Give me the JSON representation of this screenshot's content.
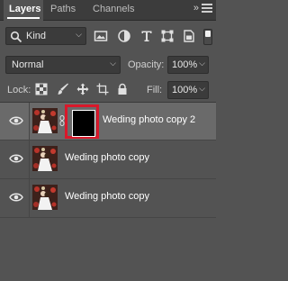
{
  "tabs": [
    {
      "label": "Layers",
      "active": true
    },
    {
      "label": "Paths",
      "active": false
    },
    {
      "label": "Channels",
      "active": false
    }
  ],
  "tabbar": {
    "collapse_label": "»",
    "menu_icon": "panel-menu-icon"
  },
  "filter": {
    "kind_label": "Kind",
    "filter_icons": [
      "pixel-layer-filter-icon",
      "adjustment-layer-filter-icon",
      "type-layer-filter-icon",
      "shape-layer-filter-icon",
      "smart-object-filter-icon"
    ]
  },
  "blend": {
    "mode": "Normal",
    "opacity_label": "Opacity:",
    "opacity_value": "100%"
  },
  "lock": {
    "label": "Lock:",
    "icons": [
      "lock-transparent-pixels-icon",
      "lock-image-pixels-icon",
      "lock-position-icon",
      "lock-artboard-icon",
      "lock-all-icon"
    ],
    "fill_label": "Fill:",
    "fill_value": "100%"
  },
  "layers": [
    {
      "name": "Weding photo copy 2",
      "selected": true,
      "has_mask": true,
      "visible": true
    },
    {
      "name": "Weding photo copy",
      "selected": false,
      "has_mask": false,
      "visible": true
    },
    {
      "name": "Weding photo copy",
      "selected": false,
      "has_mask": false,
      "visible": true
    }
  ],
  "colors": {
    "panel_bg": "#535353",
    "selected_row": "#6a6a6a",
    "mask_highlight": "#d9182a"
  }
}
